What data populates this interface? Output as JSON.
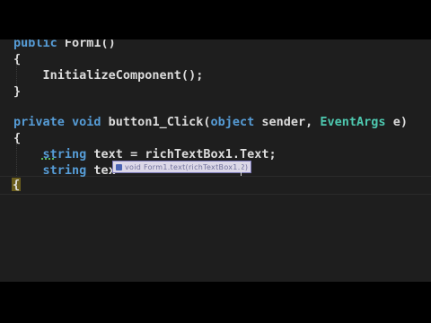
{
  "editor": {
    "lines": {
      "l1": {
        "kw": "public",
        "rest": " Form1()"
      },
      "l2": {
        "text": "{"
      },
      "l3": {
        "text": "    InitializeComponent();"
      },
      "l4": {
        "text": "}"
      },
      "l6": {
        "kw1": "private",
        "kw2": " void",
        "name": " button1_Click(",
        "kw3": "object",
        "mid": " sender, ",
        "type": "EventArgs",
        "end": " e)"
      },
      "l7": {
        "text": "{"
      },
      "l8": {
        "indent": "    ",
        "kw": "string",
        "rest": " text = richTextBox1.Text;"
      },
      "l9": {
        "indent": "    ",
        "kw": "string",
        "rest": " tex"
      },
      "l10": {
        "text": "{"
      }
    },
    "intellisense": {
      "text": "void Form1.text(richTextBox1.2)",
      "icon": "method-icon"
    },
    "colors": {
      "background": "#1e1e1e",
      "keyword": "#569cd6",
      "type": "#4ec9b0",
      "text": "#dcdcdc"
    }
  }
}
